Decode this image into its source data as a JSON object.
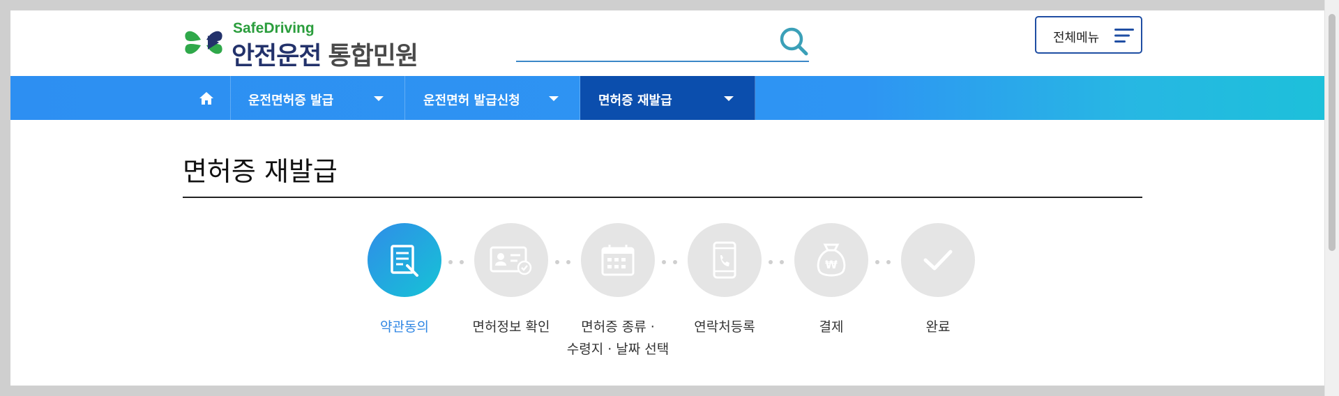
{
  "logo": {
    "en": "SafeDriving",
    "ko_main": "안전운전",
    "ko_sub": "통합민원"
  },
  "search": {
    "value": "",
    "placeholder": ""
  },
  "header": {
    "menu_label": "전체메뉴"
  },
  "nav": {
    "items": [
      {
        "label": "운전면허증 발급",
        "active": false
      },
      {
        "label": "운전면허 발급신청",
        "active": false
      },
      {
        "label": "면허증 재발급",
        "active": true
      }
    ]
  },
  "page": {
    "title": "면허증 재발급"
  },
  "steps": [
    {
      "line1": "약관동의",
      "line2": "",
      "icon": "document-edit-icon",
      "active": true
    },
    {
      "line1": "면허정보 확인",
      "line2": "",
      "icon": "id-card-check-icon",
      "active": false
    },
    {
      "line1": "면허증 종류 ·",
      "line2": "수령지 · 날짜 선택",
      "icon": "calendar-icon",
      "active": false
    },
    {
      "line1": "연락처등록",
      "line2": "",
      "icon": "phone-icon",
      "active": false
    },
    {
      "line1": "결제",
      "line2": "",
      "icon": "money-bag-icon",
      "active": false
    },
    {
      "line1": "완료",
      "line2": "",
      "icon": "checkmark-icon",
      "active": false
    }
  ],
  "colors": {
    "brand_navy": "#23326b",
    "brand_green": "#2a9d3c",
    "nav_blue": "#2e95f3",
    "nav_active": "#0b4ead",
    "step_active": "#2f86e3",
    "step_inactive": "#e5e5e5"
  }
}
